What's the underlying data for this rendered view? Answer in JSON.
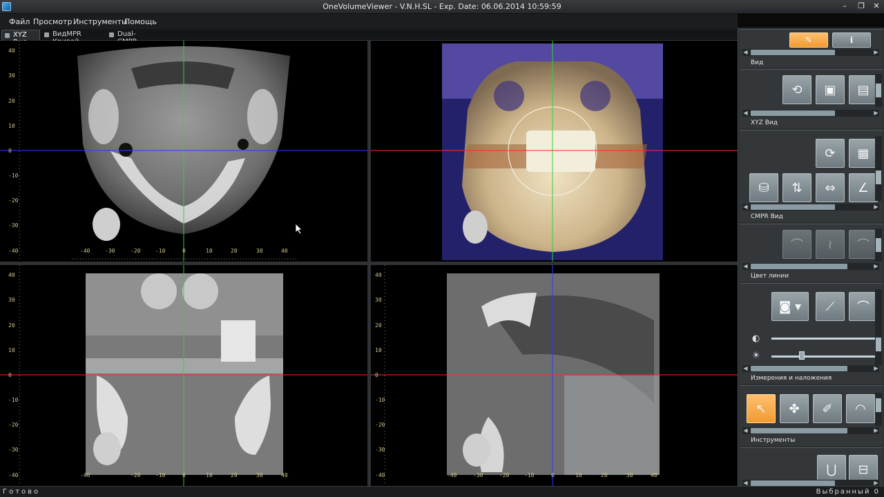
{
  "window": {
    "title": "OneVolumeViewer - V.N.H.SL - Exp. Date: 06.06.2014 10:59:59",
    "minimize": "–",
    "restore": "❐",
    "close": "✕"
  },
  "menu": [
    "Файл",
    "Просмотр",
    "Инструменты",
    "Помощь"
  ],
  "tabs": [
    {
      "label": "XYZ Вид",
      "active": true
    },
    {
      "label": "ВидMPR Кривой",
      "active": false
    },
    {
      "label": "Dual-CMPR",
      "active": false
    }
  ],
  "rulers": {
    "y_ticks": [
      "40",
      "30",
      "20",
      "10",
      "0",
      "-10",
      "-20",
      "-30",
      "-40"
    ],
    "x_ticks": [
      "-40",
      "-30",
      "-20",
      "-10",
      "0",
      "10",
      "20",
      "30",
      "40"
    ]
  },
  "colors": {
    "axis_green": "#33d13a",
    "axis_blue": "#2a3cff",
    "axis_red": "#ff2a2a",
    "ruler_text": "#cfc58b",
    "accent_orange": "#f19a30"
  },
  "panel": {
    "sections": [
      {
        "label": "Вид"
      },
      {
        "label": "XYZ Вид"
      },
      {
        "label": "CMPR Вид"
      },
      {
        "label": "Цвет линии"
      },
      {
        "label": "Измерения и наложения"
      },
      {
        "label": "Инструменты"
      }
    ]
  },
  "status": {
    "left": "Готово",
    "right": "Выбранный 0"
  }
}
